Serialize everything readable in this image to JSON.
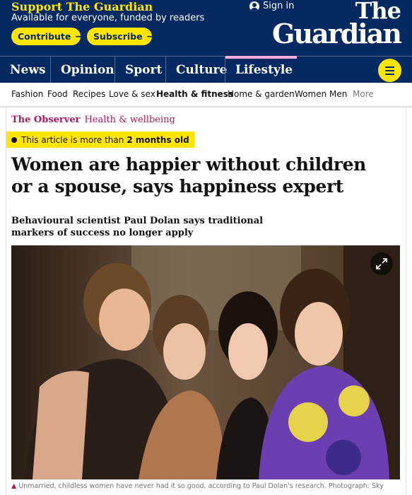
{
  "support": {
    "title": "Support The Guardian",
    "subtitle": "Available for everyone, funded by readers",
    "contribute_label": "Contribute",
    "subscribe_label": "Subscribe",
    "arrow": "→"
  },
  "account": {
    "signin_label": "Sign in"
  },
  "logo": {
    "line1": "The",
    "line2": "Guardian"
  },
  "pillars": [
    "News",
    "Opinion",
    "Sport",
    "Culture",
    "Lifestyle"
  ],
  "subnav": [
    "Fashion",
    "Food",
    "Recipes",
    "Love & sex",
    "Health & fitness",
    "Home & garden",
    "Women",
    "Men",
    "More"
  ],
  "article": {
    "section": "The Observer",
    "subsection": "Health & wellbeing",
    "age_prefix": "This article is more than",
    "age_value": "2 months old",
    "headline": "Women are happier without children or a spouse, says happiness expert",
    "standfirst": "Behavioural scientist Paul Dolan says traditional markers of success no longer apply",
    "caption": "Unmarried, childless women have never had it so good, according to Paul Dolan's research. Photograph: Sky"
  },
  "colors": {
    "brand": "#052962",
    "support_yellow": "#ffe500",
    "lifestyle_pink": "#ffabdb",
    "section_accent": "#ad1a5c"
  }
}
